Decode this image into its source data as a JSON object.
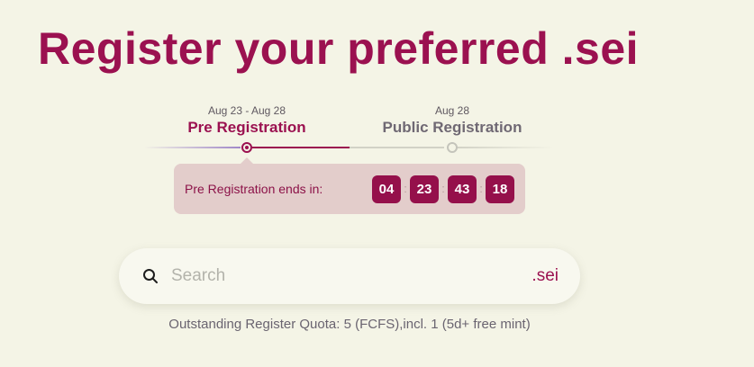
{
  "title": "Register your preferred .sei",
  "stages": [
    {
      "date": "Aug 23 - Aug 28",
      "label": "Pre Registration",
      "active": true
    },
    {
      "date": "Aug 28",
      "label": "Public Registration",
      "active": false
    }
  ],
  "countdown": {
    "label": "Pre Registration ends in:",
    "values": [
      "04",
      "23",
      "43",
      "18"
    ],
    "separator": ":"
  },
  "search": {
    "placeholder": "Search",
    "value": "",
    "suffix": ".sei",
    "icon": "search-icon"
  },
  "quota": {
    "text": "Outstanding Register Quota: 5 (FCFS),incl. 1 (5d+ free mint)"
  },
  "colors": {
    "background": "#f4f4e6",
    "accent": "#9b1150",
    "countdown_bg": "#e3cdcb",
    "digit_bg": "#95104b"
  }
}
